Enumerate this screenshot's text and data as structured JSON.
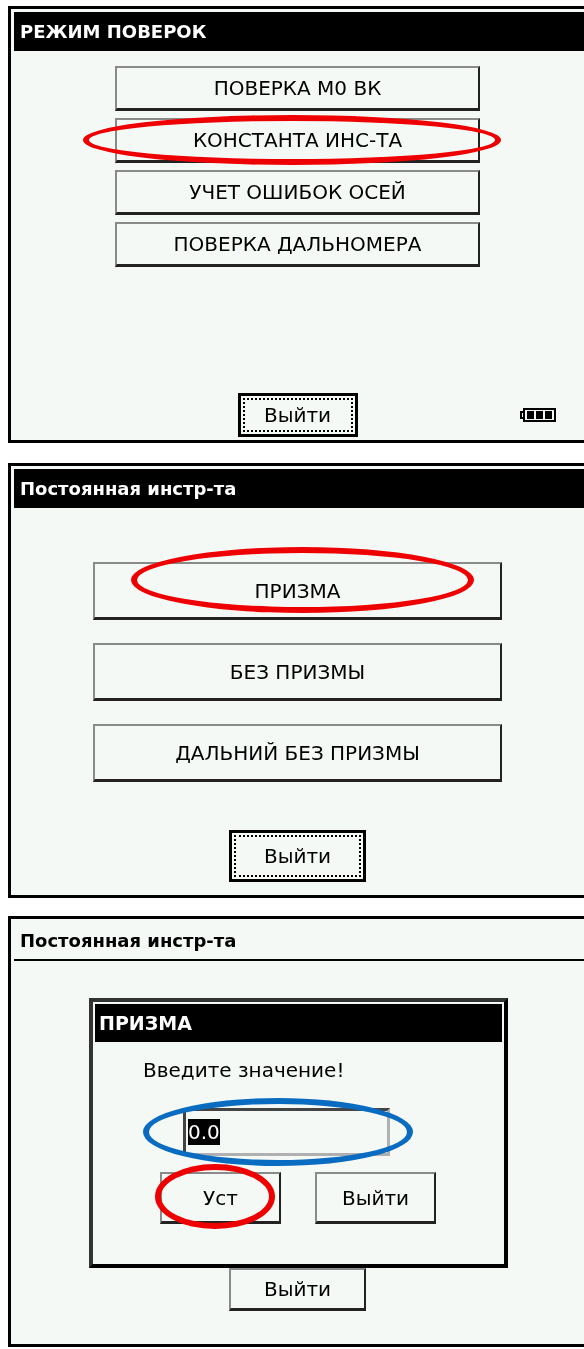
{
  "screens": [
    {
      "kind": "menu",
      "title": "РЕЖИМ ПОВЕРОК",
      "title_active": true,
      "battery": true,
      "buttons": [
        {
          "label": "ПОВЕРКА М0 ВК",
          "circled": false
        },
        {
          "label": "КОНСТАНТА ИНС-ТА",
          "circled": true
        },
        {
          "label": "УЧЕТ ОШИБОК ОСЕЙ",
          "circled": false
        },
        {
          "label": "ПОВЕРКА ДАЛЬНОМЕРА",
          "circled": false
        }
      ],
      "exit": {
        "label": "Выйти",
        "focused": true
      }
    },
    {
      "kind": "choice",
      "title": "Постоянная инстр-та",
      "title_active": true,
      "buttons": [
        {
          "label": "ПРИЗМА",
          "circled": true
        },
        {
          "label": "БЕЗ ПРИЗМЫ",
          "circled": false
        },
        {
          "label": "ДАЛЬНИЙ БЕЗ ПРИЗМЫ",
          "circled": false
        }
      ],
      "exit": {
        "label": "Выйти",
        "focused": true
      }
    },
    {
      "kind": "dialog",
      "title": "Постоянная инстр-та",
      "title_active": false,
      "exit": {
        "label": "Выйти",
        "focused": false
      },
      "dialog": {
        "title": "ПРИЗМА",
        "prompt": "Введите значение!",
        "value": "0.0",
        "value_selected": true,
        "value_circled": true,
        "buttons": [
          {
            "label": "Уст",
            "circled": true
          },
          {
            "label": "Выйти",
            "circled": false
          }
        ]
      }
    }
  ]
}
